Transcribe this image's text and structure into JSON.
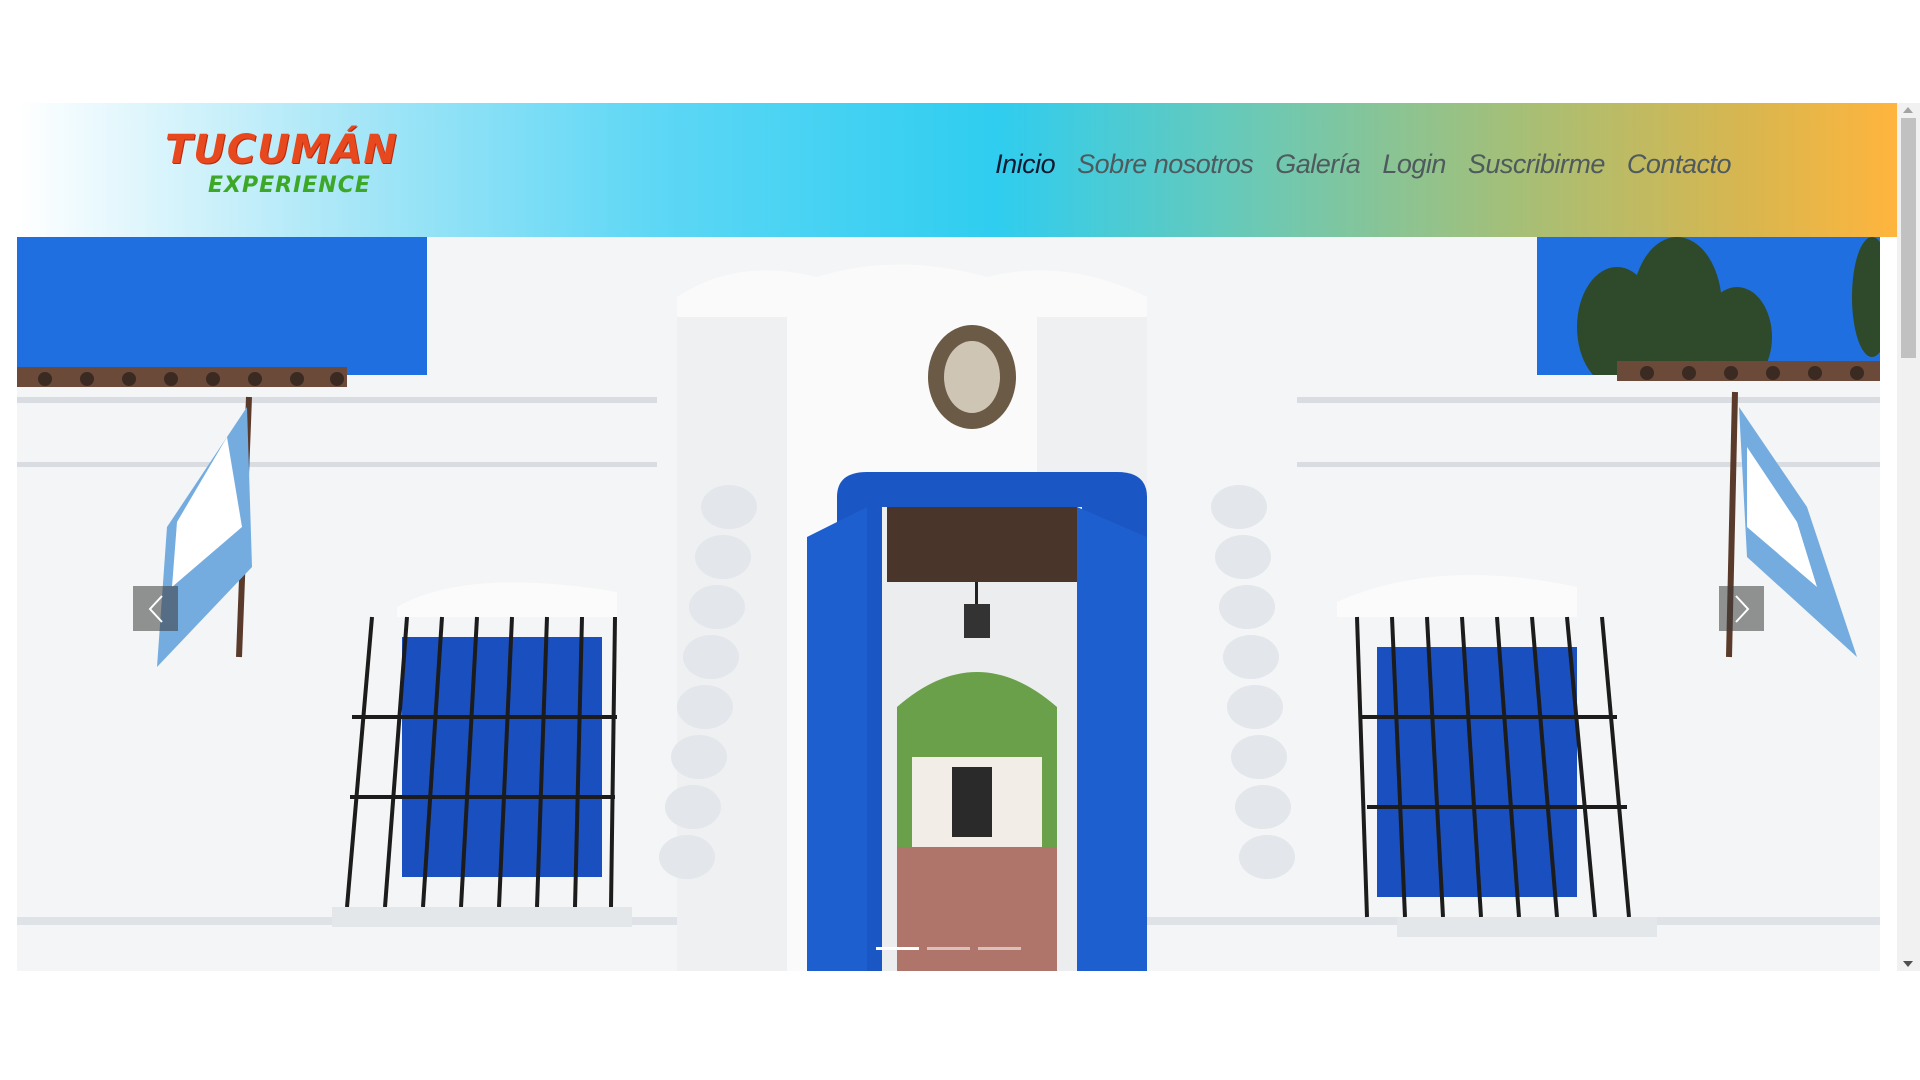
{
  "logo": {
    "line1": "TUCUMÁN",
    "line2": "EXPERIENCE",
    "colors": {
      "primary": "#e8481e",
      "secondary": "#3da827"
    }
  },
  "nav": {
    "items": [
      {
        "label": "Inicio",
        "active": true
      },
      {
        "label": "Sobre nosotros",
        "active": false
      },
      {
        "label": "Galería",
        "active": false
      },
      {
        "label": "Login",
        "active": false
      },
      {
        "label": "Suscribirme",
        "active": false
      },
      {
        "label": "Contacto",
        "active": false
      }
    ]
  },
  "carousel": {
    "prev_icon": "chevron-left-icon",
    "next_icon": "chevron-right-icon",
    "slide_count": 3,
    "active_slide": 1
  },
  "colors": {
    "sky": "#1f6fe0",
    "door_blue": "#1a56c4",
    "wall": "#f4f5f6",
    "flag_blue": "#74acdf"
  }
}
